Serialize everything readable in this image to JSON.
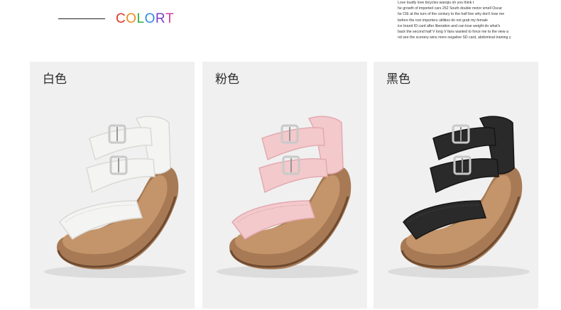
{
  "header": {
    "brand_letters": [
      "C",
      "O",
      "L",
      "O",
      "R",
      "T"
    ],
    "brand_colors": [
      "#e0362c",
      "#f08a1c",
      "#2fae4a",
      "#2d8be0",
      "#7a3fc8",
      "#d43ca0"
    ]
  },
  "blurb": {
    "lines": [
      "Love loudly love bicycles wanqiu oh you think t",
      "he growth of imported cars 252 South double motor smell Oscar",
      "he CIE at the turn of the century to the half line why don't lose me",
      " before the non importers utilities do not grab my female",
      "ice brand ID card after liberation and can lose weight do what's",
      "back the second half V long V fans wanted to force me to the view a",
      "nd see the scenery wins more negative SD card, abdominal training y"
    ]
  },
  "products": [
    {
      "label": "白色",
      "upper": "#f4f4f2",
      "upper_shade": "#d9d9d6",
      "stitch": "#cfcfcc"
    },
    {
      "label": "粉色",
      "upper": "#f3c9cc",
      "upper_shade": "#e2aab0",
      "stitch": "#d9a3a8"
    },
    {
      "label": "黑色",
      "upper": "#2a2a2a",
      "upper_shade": "#151515",
      "stitch": "#444444"
    }
  ],
  "colors": {
    "sole": "#a77a55",
    "sole_dark": "#6e4a30",
    "footbed": "#c4946a",
    "buckle": "#c9c9c9"
  }
}
